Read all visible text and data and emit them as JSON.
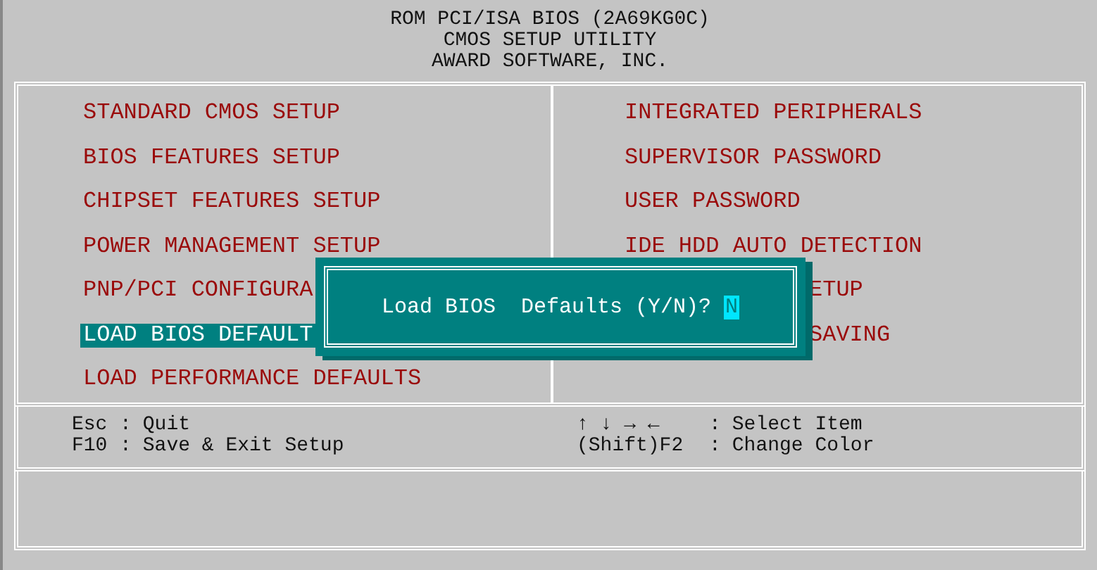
{
  "header": {
    "lines": [
      "ROM PCI/ISA BIOS (2A69KG0C)",
      "CMOS SETUP UTILITY",
      "AWARD SOFTWARE, INC."
    ]
  },
  "menu": {
    "left": [
      {
        "label": "STANDARD CMOS SETUP",
        "selected": false,
        "kind": "full"
      },
      {
        "label": "BIOS FEATURES SETUP",
        "selected": false,
        "kind": "full"
      },
      {
        "label": "CHIPSET FEATURES SETUP",
        "selected": false,
        "kind": "full"
      },
      {
        "label": "POWER MANAGEMENT SETUP",
        "selected": false,
        "kind": "full"
      },
      {
        "label": "PNP/PCI CONFIGURA",
        "selected": false,
        "kind": "full"
      },
      {
        "label": "LOAD BIOS DEFAULT",
        "selected": true,
        "kind": "full"
      },
      {
        "label": "LOAD PERFORMANCE DEFAULTS",
        "selected": false,
        "kind": "full"
      }
    ],
    "right": [
      {
        "label": "INTEGRATED PERIPHERALS",
        "selected": false,
        "kind": "full"
      },
      {
        "label": "SUPERVISOR PASSWORD",
        "selected": false,
        "kind": "full"
      },
      {
        "label": "USER PASSWORD",
        "selected": false,
        "kind": "full"
      },
      {
        "label": "IDE HDD AUTO DETECTION",
        "selected": false,
        "kind": "full"
      },
      {
        "label": "ETUP",
        "selected": false,
        "kind": "tail"
      },
      {
        "label": "SAVING",
        "selected": false,
        "kind": "tail"
      }
    ]
  },
  "dialog": {
    "prompt": "Load BIOS  Defaults (Y/N)?",
    "answer": "N"
  },
  "help": {
    "left": [
      {
        "key": "Esc",
        "separator": ":",
        "action": "Quit"
      },
      {
        "key": "F10",
        "separator": ":",
        "action": "Save & Exit Setup"
      }
    ],
    "right": [
      {
        "key": "↑ ↓ → ←",
        "separator": ":",
        "action": "Select Item"
      },
      {
        "key": "(Shift)F2",
        "separator": ":",
        "action": "Change Color"
      }
    ]
  }
}
